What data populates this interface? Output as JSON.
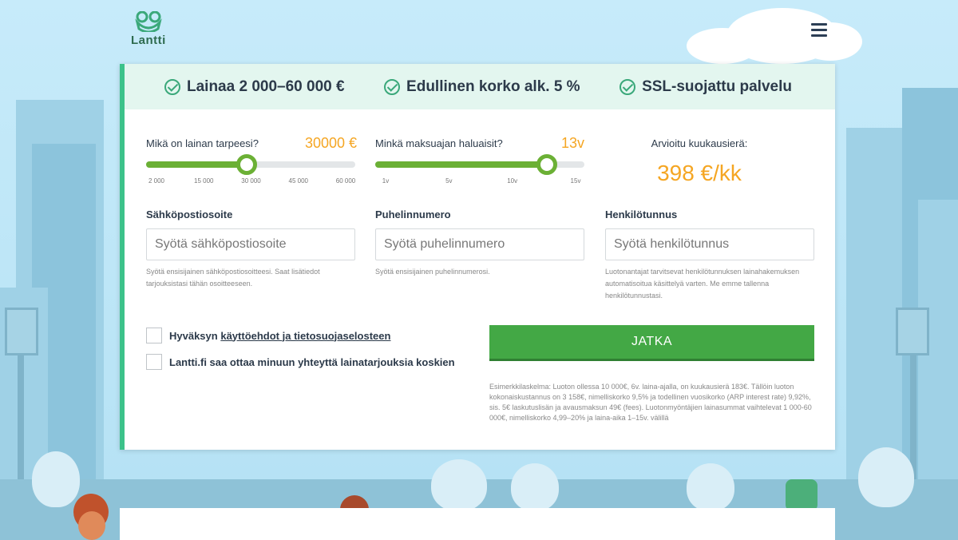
{
  "header": {
    "logo_text": "Lantti"
  },
  "benefits": [
    {
      "label": "Lainaa 2 000–60 000 €"
    },
    {
      "label": "Edullinen korko alk. 5 %"
    },
    {
      "label": "SSL-suojattu palvelu"
    }
  ],
  "amount": {
    "label": "Mikä on lainan tarpeesi?",
    "value": "30000 €",
    "fraction": 0.48,
    "ticks": [
      "2 000",
      "15 000",
      "30 000",
      "45 000",
      "60 000"
    ]
  },
  "period": {
    "label": "Minkä maksuajan haluaisit?",
    "value": "13v",
    "fraction": 0.82,
    "ticks": [
      "1v",
      "5v",
      "10v",
      "15v"
    ]
  },
  "estimate": {
    "label": "Arvioitu kuukausierä:",
    "value": "398 €/kk"
  },
  "fields": {
    "email": {
      "label": "Sähköpostiosoite",
      "placeholder": "Syötä sähköpostiosoite",
      "help": "Syötä ensisijainen sähköpostiosoitteesi. Saat lisätiedot tarjouksistasi tähän osoitteeseen."
    },
    "phone": {
      "label": "Puhelinnumero",
      "placeholder": "Syötä puhelinnumero",
      "help": "Syötä ensisijainen puhelinnumerosi."
    },
    "ssn": {
      "label": "Henkilötunnus",
      "placeholder": "Syötä henkilötunnus",
      "help": "Luotonantajat tarvitsevat henkilötunnuksen lainahakemuksen automatisoitua käsittelyä varten. Me emme tallenna henkilötunnustasi."
    }
  },
  "consents": {
    "terms_prefix": "Hyväksyn",
    "terms_link": "käyttöehdot ja tietosuojaselosteen",
    "contact": "Lantti.fi saa ottaa minuun yhteyttä lainatarjouksia koskien"
  },
  "submit_label": "JATKA",
  "disclaimer": "Esimerkkilaskelma: Luoton ollessa 10 000€, 6v. laina-ajalla, on kuukausierä 183€. Tällöin luoton kokonaiskustannus on 3 158€, nimelliskorko 9,5% ja todellinen vuosikorko (ARP interest rate) 9,92%, sis. 5€ laskutuslisän ja avausmaksun 49€ (fees). Luotonmyöntäjien lainasummat vaihtelevat 1 000-60 000€, nimelliskorko 4,99–20% ja laina-aika 1–15v. välillä",
  "colors": {
    "accent_green": "#43a845",
    "slider_green": "#6bb035",
    "highlight_orange": "#f5a623",
    "benefit_bg": "#e3f6ef"
  }
}
